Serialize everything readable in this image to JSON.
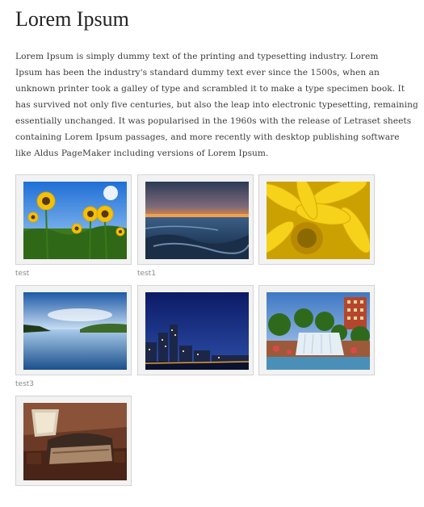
{
  "page": {
    "title": "Lorem Ipsum",
    "intro_lines": [
      "Lorem Ipsum is simply dummy text of the printing and typesetting industry. Lorem",
      "Ipsum has been the industry's standard dummy text ever since the 1500s, when an",
      "unknown printer took a galley of type and scrambled it to make a type specimen book. It",
      "has survived not only five centuries, but also the leap into electronic typesetting, remaining",
      "essentially unchanged. It was popularised in the 1960s with the release of Letraset sheets",
      "containing Lorem Ipsum passages, and more recently with desktop publishing software",
      "like Aldus PageMaker including versions of Lorem Ipsum."
    ]
  },
  "gallery": {
    "items": [
      {
        "caption": "test",
        "image": "sunflowers-photo"
      },
      {
        "caption": "test1",
        "image": "sunset-beach-photo"
      },
      {
        "caption": "",
        "image": "yellow-flower-photo"
      },
      {
        "caption": "test3",
        "image": "lake-landscape-photo"
      },
      {
        "caption": "",
        "image": "night-city-photo"
      },
      {
        "caption": "",
        "image": "waterfall-resort-photo"
      },
      {
        "caption": "",
        "image": "bedroom-photo"
      }
    ]
  }
}
